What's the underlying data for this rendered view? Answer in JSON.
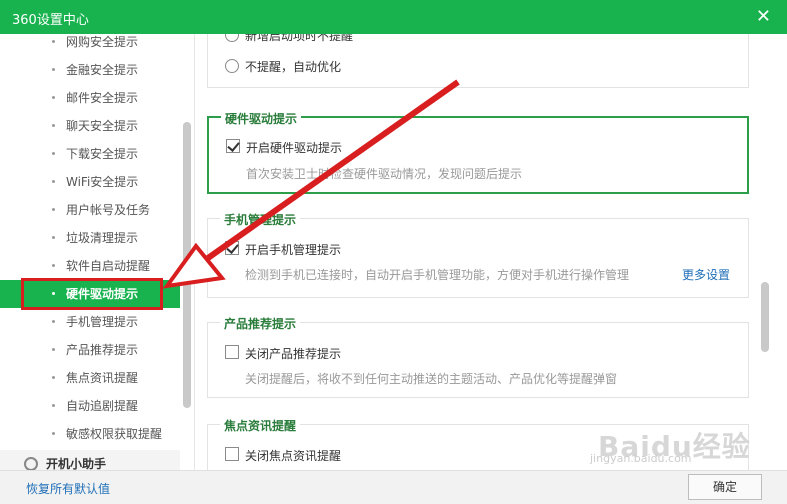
{
  "titlebar": {
    "title": "360设置中心",
    "close": "✕"
  },
  "sidebar": {
    "items": [
      {
        "label": "网购安全提示",
        "active": false
      },
      {
        "label": "金融安全提示",
        "active": false
      },
      {
        "label": "邮件安全提示",
        "active": false
      },
      {
        "label": "聊天安全提示",
        "active": false
      },
      {
        "label": "下载安全提示",
        "active": false
      },
      {
        "label": "WiFi安全提示",
        "active": false
      },
      {
        "label": "用户帐号及任务",
        "active": false
      },
      {
        "label": "垃圾清理提示",
        "active": false
      },
      {
        "label": "软件自启动提醒",
        "active": false
      },
      {
        "label": "硬件驱动提示",
        "active": true
      },
      {
        "label": "手机管理提示",
        "active": false
      },
      {
        "label": "产品推荐提示",
        "active": false
      },
      {
        "label": "焦点资讯提醒",
        "active": false
      },
      {
        "label": "自动追剧提醒",
        "active": false
      },
      {
        "label": "敏感权限获取提醒",
        "active": false
      }
    ],
    "group_label": "开机小助手"
  },
  "main": {
    "startup": {
      "option_partial": "新增启动项时不提醒",
      "option_auto": "不提醒，自动优化"
    },
    "hardware": {
      "legend": "硬件驱动提示",
      "check_label": "开启硬件驱动提示",
      "desc": "首次安装卫士时检查硬件驱动情况，发现问题后提示",
      "checked": true
    },
    "phone": {
      "legend": "手机管理提示",
      "check_label": "开启手机管理提示",
      "desc": "检测到手机已连接时，自动开启手机管理功能，方便对手机进行操作管理",
      "more": "更多设置",
      "checked": true
    },
    "product": {
      "legend": "产品推荐提示",
      "check_label": "关闭产品推荐提示",
      "desc": "关闭提醒后，将收不到任何主动推送的主题活动、产品优化等提醒弹窗",
      "checked": false
    },
    "news": {
      "legend": "焦点资讯提醒",
      "check_label": "关闭焦点资讯提醒",
      "checked": false
    }
  },
  "footer": {
    "reset": "恢复所有默认值",
    "confirm": "确定"
  },
  "watermark": {
    "big": "Baidu经验",
    "small": "jingyan.baidu.com"
  },
  "colors": {
    "accent": "#18b34f",
    "highlight": "#d81e1e",
    "link": "#1f6fb8"
  }
}
